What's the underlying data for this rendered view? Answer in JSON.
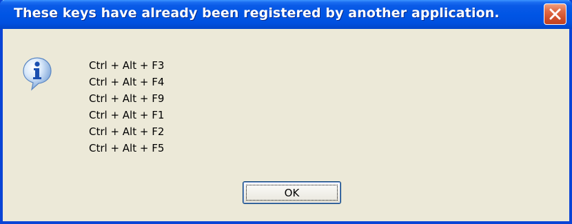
{
  "dialog": {
    "title": "These keys have already been registered by another application.",
    "icon": "info-icon",
    "keys": [
      "Ctrl + Alt + F3",
      "Ctrl + Alt + F4",
      "Ctrl + Alt + F9",
      "Ctrl + Alt + F1",
      "Ctrl + Alt + F2",
      "Ctrl + Alt + F5"
    ],
    "ok_label": "OK"
  },
  "colors": {
    "titlebar": "#0055e5",
    "close_button": "#d0502c",
    "window_background": "#ece9d8"
  }
}
